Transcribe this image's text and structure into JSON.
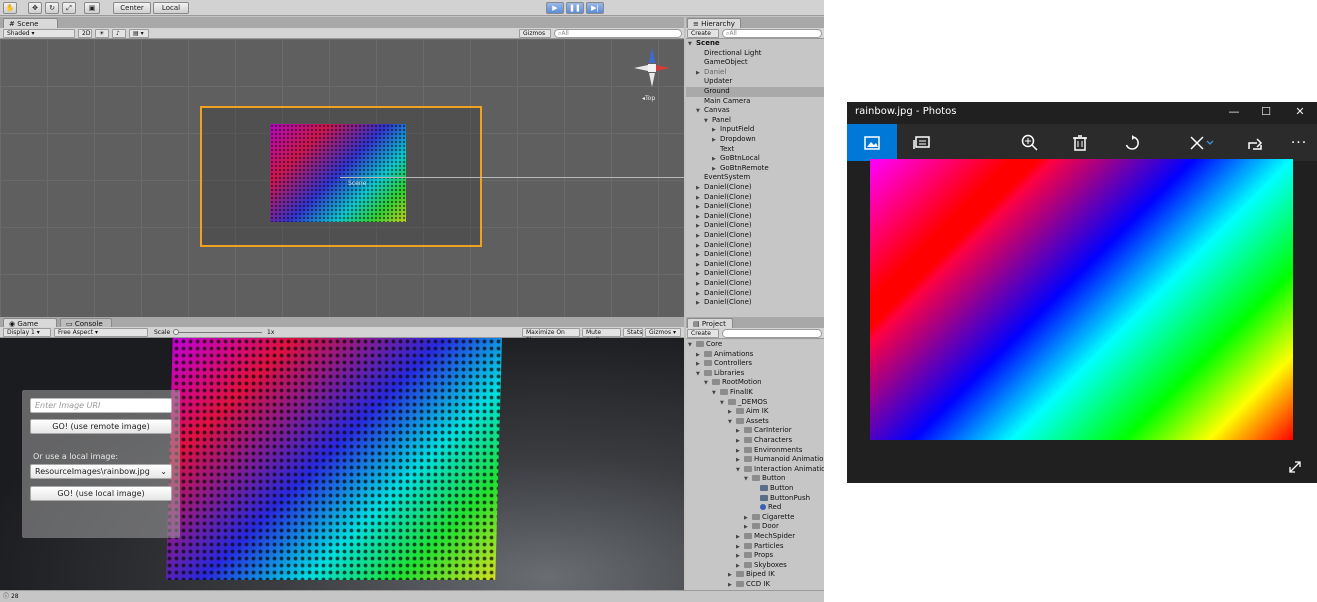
{
  "unity": {
    "toolbar": {
      "pivot_label": "Center",
      "space_label": "Local"
    },
    "scene": {
      "tab_label": "Scene",
      "shading_mode": "Shaded",
      "mode_2d_label": "2D",
      "gizmos_label": "Gizmos",
      "search_placeholder": "All",
      "orientation_label": "Top",
      "scene_center_label": "Scene"
    },
    "game": {
      "tab_label": "Game",
      "console_tab_label": "Console",
      "display_label": "Display 1",
      "aspect_label": "Free Aspect",
      "scale_label": "Scale",
      "scale_value": "1x",
      "maximize_label": "Maximize On Play",
      "mute_label": "Mute Audio",
      "stats_label": "Stats",
      "gizmos_label": "Gizmos",
      "ui": {
        "uri_placeholder": "Enter Image URI",
        "remote_button": "GO! (use remote image)",
        "local_prompt": "Or use a local image:",
        "local_select_value": "ResourceImages\\rainbow.jpg",
        "local_button": "GO! (use local image)"
      }
    },
    "hierarchy": {
      "tab_label": "Hierarchy",
      "create_label": "Create",
      "search_placeholder": "All",
      "items": [
        {
          "label": "Scene",
          "indent": 0,
          "arrow": "open",
          "state": "bold"
        },
        {
          "label": "Directional Light",
          "indent": 1,
          "arrow": "",
          "state": ""
        },
        {
          "label": "GameObject",
          "indent": 1,
          "arrow": "",
          "state": ""
        },
        {
          "label": "Daniel",
          "indent": 1,
          "arrow": "closed",
          "state": "dim"
        },
        {
          "label": "Updater",
          "indent": 1,
          "arrow": "",
          "state": ""
        },
        {
          "label": "Ground",
          "indent": 1,
          "arrow": "",
          "state": "highlight"
        },
        {
          "label": "Main Camera",
          "indent": 1,
          "arrow": "",
          "state": ""
        },
        {
          "label": "Canvas",
          "indent": 1,
          "arrow": "open",
          "state": ""
        },
        {
          "label": "Panel",
          "indent": 2,
          "arrow": "open",
          "state": ""
        },
        {
          "label": "InputField",
          "indent": 3,
          "arrow": "closed",
          "state": ""
        },
        {
          "label": "Dropdown",
          "indent": 3,
          "arrow": "closed",
          "state": ""
        },
        {
          "label": "Text",
          "indent": 3,
          "arrow": "",
          "state": ""
        },
        {
          "label": "GoBtnLocal",
          "indent": 3,
          "arrow": "closed",
          "state": ""
        },
        {
          "label": "GoBtnRemote",
          "indent": 3,
          "arrow": "closed",
          "state": ""
        },
        {
          "label": "EventSystem",
          "indent": 1,
          "arrow": "",
          "state": ""
        },
        {
          "label": "Daniel(Clone)",
          "indent": 1,
          "arrow": "closed",
          "state": ""
        },
        {
          "label": "Daniel(Clone)",
          "indent": 1,
          "arrow": "closed",
          "state": ""
        },
        {
          "label": "Daniel(Clone)",
          "indent": 1,
          "arrow": "closed",
          "state": ""
        },
        {
          "label": "Daniel(Clone)",
          "indent": 1,
          "arrow": "closed",
          "state": ""
        },
        {
          "label": "Daniel(Clone)",
          "indent": 1,
          "arrow": "closed",
          "state": ""
        },
        {
          "label": "Daniel(Clone)",
          "indent": 1,
          "arrow": "closed",
          "state": ""
        },
        {
          "label": "Daniel(Clone)",
          "indent": 1,
          "arrow": "closed",
          "state": ""
        },
        {
          "label": "Daniel(Clone)",
          "indent": 1,
          "arrow": "closed",
          "state": ""
        },
        {
          "label": "Daniel(Clone)",
          "indent": 1,
          "arrow": "closed",
          "state": ""
        },
        {
          "label": "Daniel(Clone)",
          "indent": 1,
          "arrow": "closed",
          "state": ""
        },
        {
          "label": "Daniel(Clone)",
          "indent": 1,
          "arrow": "closed",
          "state": ""
        },
        {
          "label": "Daniel(Clone)",
          "indent": 1,
          "arrow": "closed",
          "state": ""
        },
        {
          "label": "Daniel(Clone)",
          "indent": 1,
          "arrow": "closed",
          "state": ""
        }
      ]
    },
    "project": {
      "tab_label": "Project",
      "create_label": "Create",
      "items": [
        {
          "label": "Core",
          "indent": 0,
          "arrow": "open",
          "kind": "folder"
        },
        {
          "label": "Animations",
          "indent": 1,
          "arrow": "closed",
          "kind": "folder"
        },
        {
          "label": "Controllers",
          "indent": 1,
          "arrow": "closed",
          "kind": "folder"
        },
        {
          "label": "Libraries",
          "indent": 1,
          "arrow": "open",
          "kind": "folder"
        },
        {
          "label": "RootMotion",
          "indent": 2,
          "arrow": "open",
          "kind": "folder"
        },
        {
          "label": "FinalIK",
          "indent": 3,
          "arrow": "open",
          "kind": "folder"
        },
        {
          "label": "_DEMOS",
          "indent": 4,
          "arrow": "open",
          "kind": "folder"
        },
        {
          "label": "Aim IK",
          "indent": 5,
          "arrow": "closed",
          "kind": "folder"
        },
        {
          "label": "Assets",
          "indent": 5,
          "arrow": "open",
          "kind": "folder"
        },
        {
          "label": "CarInterior",
          "indent": 6,
          "arrow": "closed",
          "kind": "folder"
        },
        {
          "label": "Characters",
          "indent": 6,
          "arrow": "closed",
          "kind": "folder"
        },
        {
          "label": "Environments",
          "indent": 6,
          "arrow": "closed",
          "kind": "folder"
        },
        {
          "label": "Humanoid Animation",
          "indent": 6,
          "arrow": "closed",
          "kind": "folder"
        },
        {
          "label": "Interaction Animatio",
          "indent": 6,
          "arrow": "open",
          "kind": "folder"
        },
        {
          "label": "Button",
          "indent": 7,
          "arrow": "open",
          "kind": "folder"
        },
        {
          "label": "Button",
          "indent": 8,
          "arrow": "",
          "kind": "asset"
        },
        {
          "label": "ButtonPush",
          "indent": 8,
          "arrow": "",
          "kind": "asset"
        },
        {
          "label": "Red",
          "indent": 8,
          "arrow": "",
          "kind": "material"
        },
        {
          "label": "Cigarette",
          "indent": 7,
          "arrow": "closed",
          "kind": "folder"
        },
        {
          "label": "Door",
          "indent": 7,
          "arrow": "closed",
          "kind": "folder"
        },
        {
          "label": "MechSpider",
          "indent": 6,
          "arrow": "closed",
          "kind": "folder"
        },
        {
          "label": "Particles",
          "indent": 6,
          "arrow": "closed",
          "kind": "folder"
        },
        {
          "label": "Props",
          "indent": 6,
          "arrow": "closed",
          "kind": "folder"
        },
        {
          "label": "Skyboxes",
          "indent": 6,
          "arrow": "closed",
          "kind": "folder"
        },
        {
          "label": "Biped IK",
          "indent": 5,
          "arrow": "closed",
          "kind": "folder"
        },
        {
          "label": "CCD IK",
          "indent": 5,
          "arrow": "closed",
          "kind": "folder"
        }
      ]
    },
    "status": {
      "count": "28"
    }
  },
  "photos": {
    "title": "rainbow.jpg - Photos",
    "accent_color": "#0078d7",
    "tools": [
      "image-icon",
      "slideshow-icon",
      "zoom-in-icon",
      "delete-icon",
      "rotate-icon",
      "edit-icon",
      "share-icon",
      "more-icon"
    ],
    "more_label": "···"
  }
}
